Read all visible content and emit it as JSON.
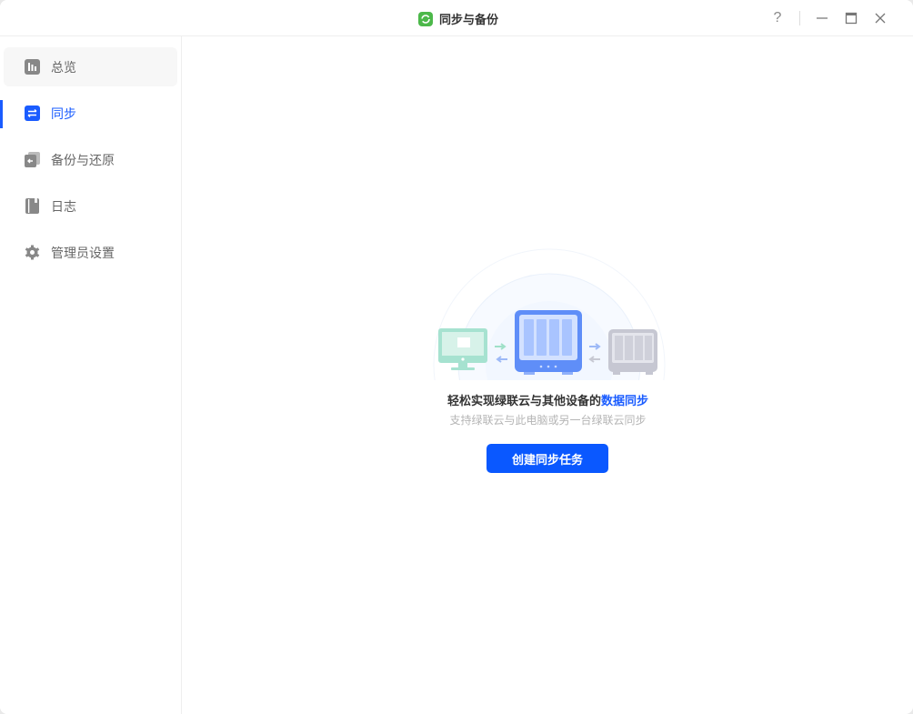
{
  "window": {
    "title": "同步与备份",
    "help": "?"
  },
  "sidebar": {
    "items": [
      {
        "label": "总览",
        "icon": "overview-icon"
      },
      {
        "label": "同步",
        "icon": "sync-icon"
      },
      {
        "label": "备份与还原",
        "icon": "backup-restore-icon"
      },
      {
        "label": "日志",
        "icon": "log-icon"
      },
      {
        "label": "管理员设置",
        "icon": "gear-icon"
      }
    ]
  },
  "main": {
    "headline": "轻松实现绿联云与其他设备的",
    "headline_highlight": "数据同步",
    "subtext": "支持绿联云与此电脑或另一台绿联云同步",
    "create_button": "创建同步任务"
  },
  "colors": {
    "accent": "#1a5cff",
    "button": "#0a58ff",
    "app_icon": "#4cb84a"
  }
}
